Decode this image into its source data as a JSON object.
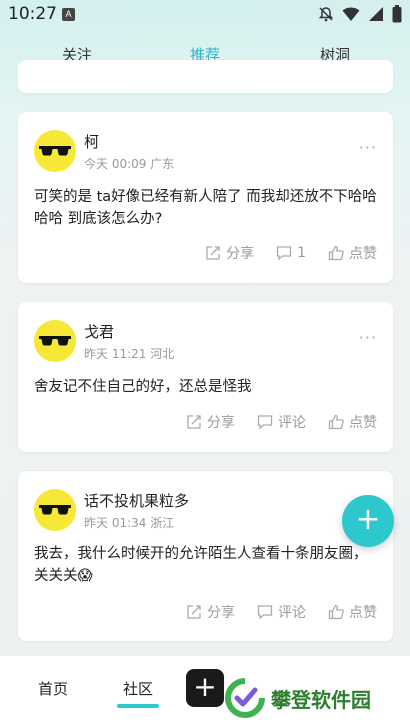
{
  "status": {
    "time": "10:27",
    "app_badge": "A"
  },
  "tabs": [
    "关注",
    "推荐",
    "树洞"
  ],
  "posts": [
    {
      "author": "柯",
      "meta": "今天 00:09 广东",
      "content": "可笑的是 ta好像已经有新人陪了 而我却还放不下哈哈哈哈 到底该怎么办?",
      "share": "分享",
      "comment": "1",
      "like": "点赞"
    },
    {
      "author": "戈君",
      "meta": "昨天 11:21 河北",
      "content": "舍友记不住自己的好，还总是怪我",
      "share": "分享",
      "comment": "评论",
      "like": "点赞"
    },
    {
      "author": "话不投机果粒多",
      "meta": "昨天 01:34 浙江",
      "content": "我去，我什么时候开的允许陌生人查看十条朋友圈，关关关😱",
      "share": "分享",
      "comment": "评论",
      "like": "点赞"
    }
  ],
  "more_label": "···",
  "fab_label": "+",
  "bottom_nav": {
    "home": "首页",
    "community": "社区",
    "add": "+"
  },
  "watermark": "攀登软件园",
  "colors": {
    "accent": "#2cb6c2",
    "fab": "#2cc8cd",
    "avatar": "#f7e838"
  }
}
